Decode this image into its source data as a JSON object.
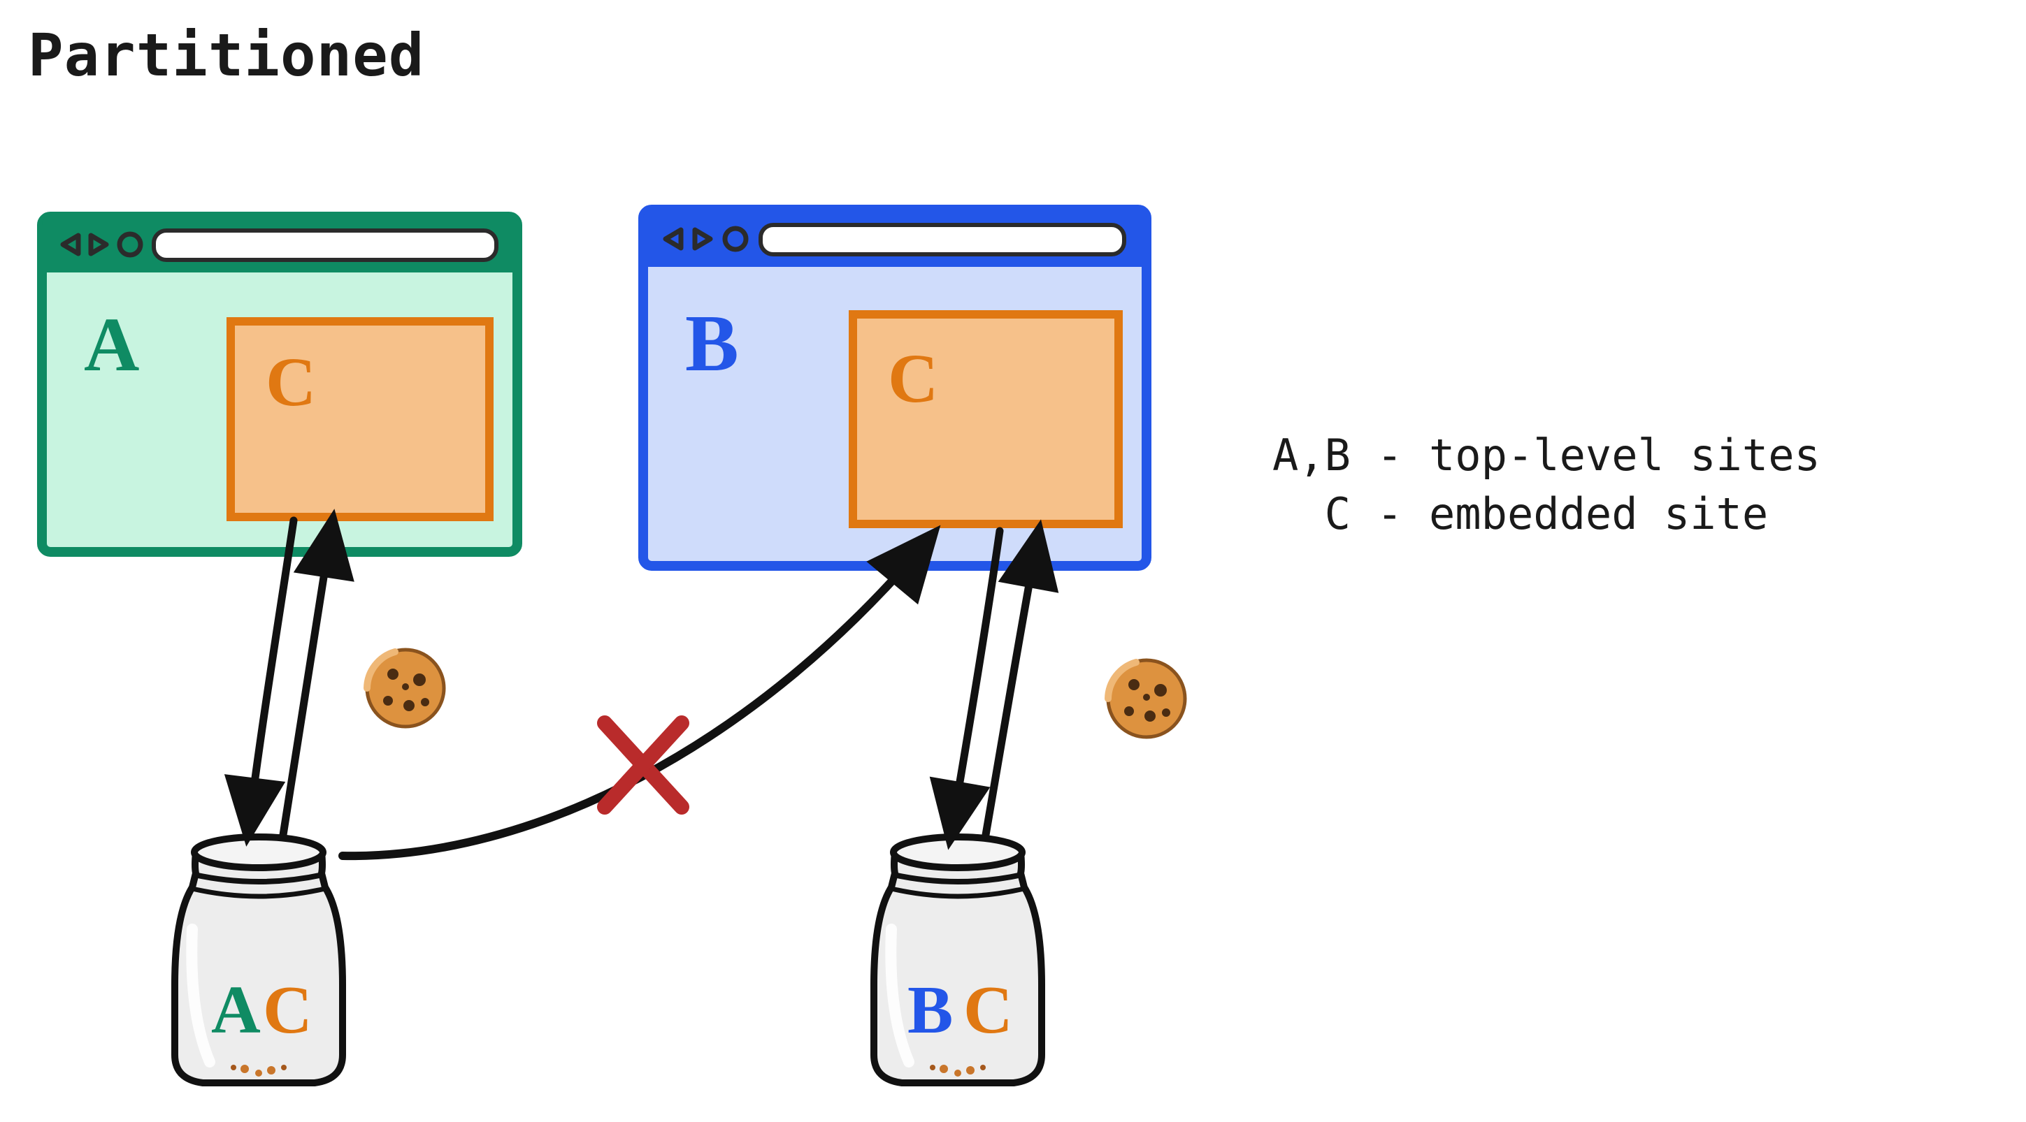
{
  "title": "Partitioned",
  "legend": {
    "line1": "A,B - top-level sites",
    "line2": "  C - embedded site"
  },
  "browsers": {
    "a": {
      "label": "A",
      "color": "#0f8b63",
      "fill": "#c8f4e0"
    },
    "b": {
      "label": "B",
      "color": "#2356e8",
      "fill": "#cfdcfb"
    }
  },
  "embedded": {
    "label": "C",
    "color": "#e07812",
    "fill": "#f6c18a"
  },
  "jars": {
    "a": {
      "label1": "A",
      "label2": "C",
      "color1": "#0f8b63",
      "color2": "#e07812"
    },
    "b": {
      "label1": "B",
      "label2": "C",
      "color1": "#2356e8",
      "color2": "#e07812"
    }
  },
  "blocked_marker": "X",
  "icons": {
    "cookie": "cookie-icon",
    "jar": "jar-icon",
    "browser_back": "back-icon",
    "browser_forward": "forward-icon",
    "browser_reload": "reload-icon"
  },
  "colors": {
    "stroke": "#111111",
    "red": "#b92b2b",
    "cookie_fill": "#dd923f",
    "cookie_chip": "#4a2c12",
    "jar_fill": "#e9e9e9",
    "toolbar_icon": "#3a3a3a"
  }
}
